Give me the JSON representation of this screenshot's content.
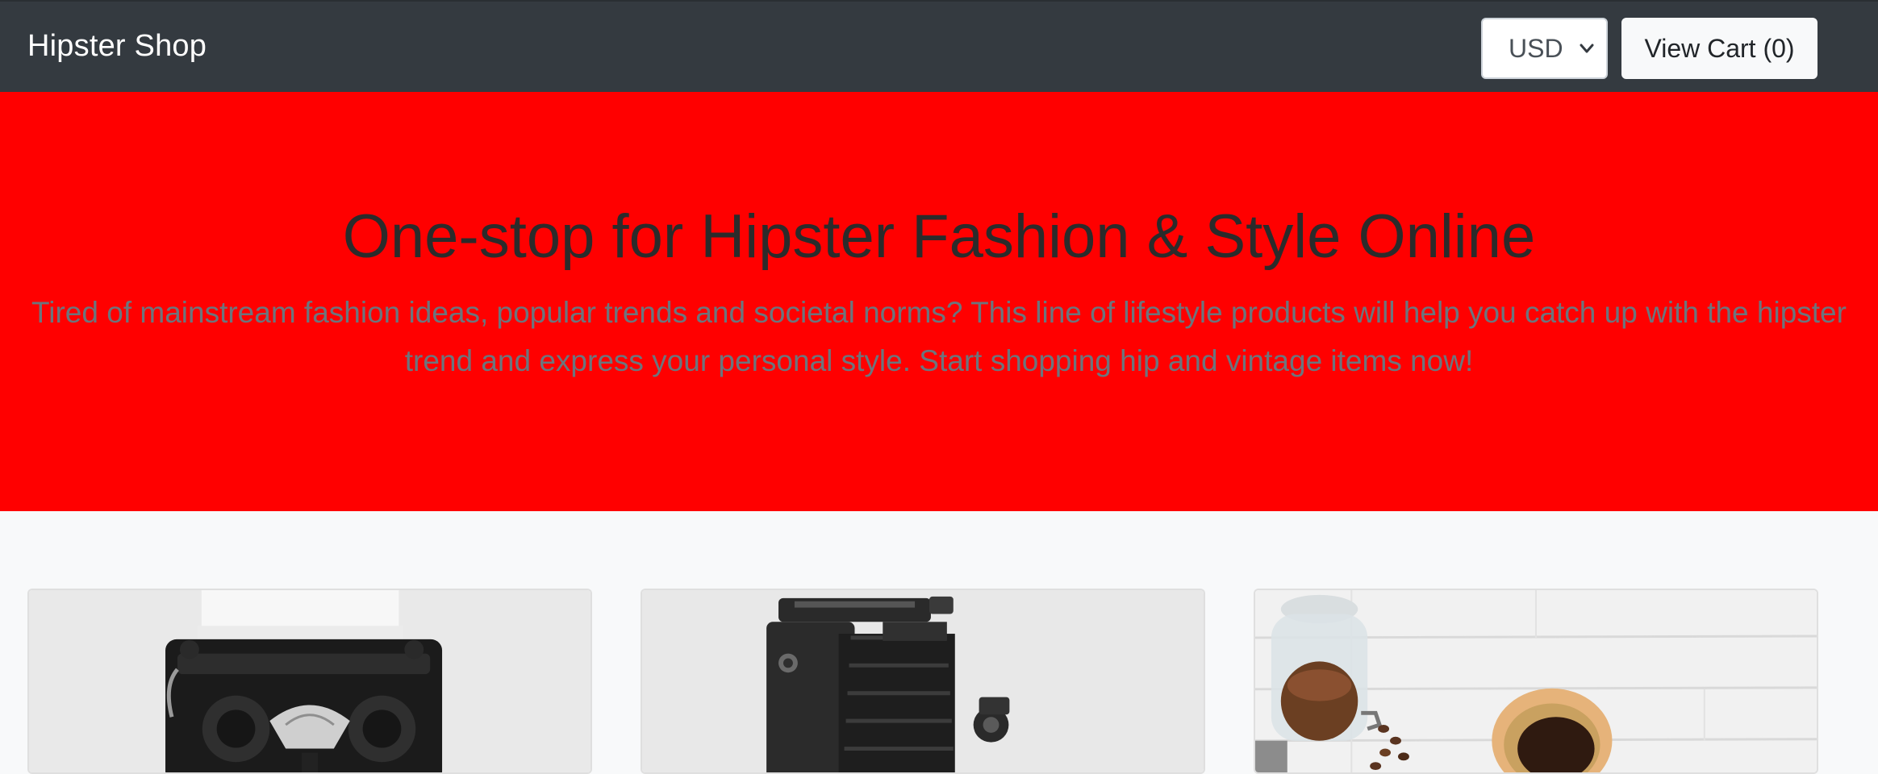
{
  "navbar": {
    "brand": "Hipster Shop",
    "currency": {
      "selected": "USD"
    },
    "cart_label": "View Cart (0)"
  },
  "hero": {
    "title": "One-stop for Hipster Fashion & Style Online",
    "lead": "Tired of mainstream fashion ideas, popular trends and societal norms? This line of lifestyle products will help you catch up with the hipster trend and express your personal style. Start shopping hip and vintage items now!",
    "background_color": "#ff0000"
  },
  "products": [
    {
      "image": "typewriter"
    },
    {
      "image": "vintage-camera"
    },
    {
      "image": "coffee-beans-and-pour-over"
    }
  ],
  "colors": {
    "navbar": "#343a40",
    "page_background": "#f8f9fa"
  }
}
